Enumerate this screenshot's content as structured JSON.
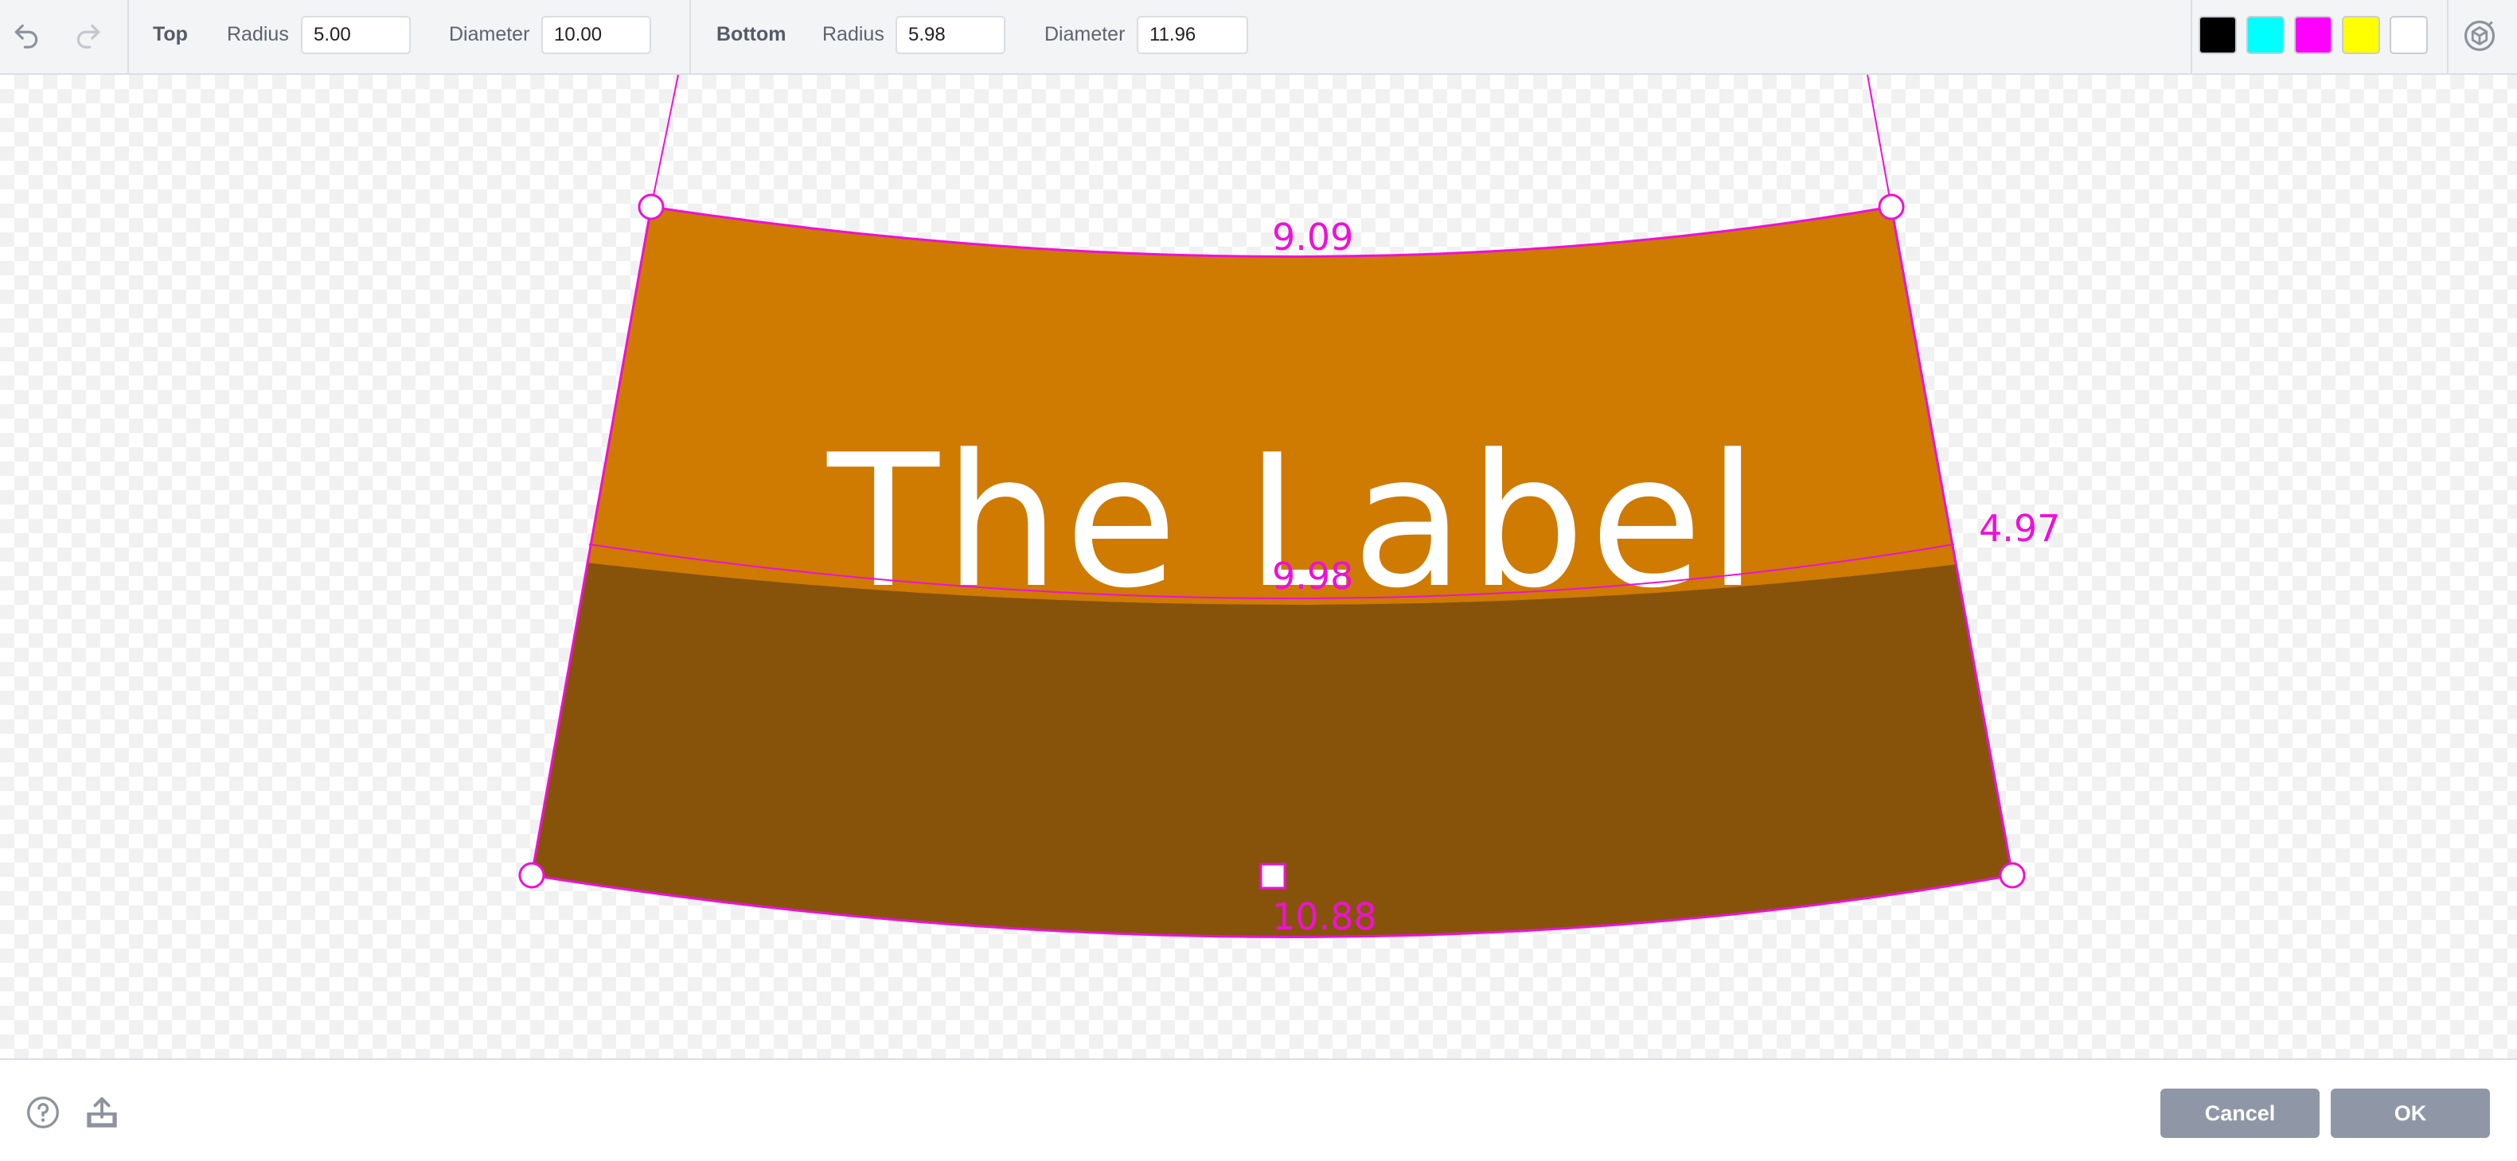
{
  "toolbar": {
    "top": {
      "section_label": "Top",
      "radius_label": "Radius",
      "radius_value": "5.00",
      "diameter_label": "Diameter",
      "diameter_value": "10.00"
    },
    "bottom": {
      "section_label": "Bottom",
      "radius_label": "Radius",
      "radius_value": "5.98",
      "diameter_label": "Diameter",
      "diameter_value": "11.96"
    },
    "icons": {
      "undo": "undo-icon",
      "redo": "redo-icon",
      "view_3d": "3d-view-icon"
    },
    "swatches": [
      {
        "name": "black",
        "color": "#000000"
      },
      {
        "name": "cyan",
        "color": "#00ffff"
      },
      {
        "name": "magenta",
        "color": "#ff00ff"
      },
      {
        "name": "yellow",
        "color": "#ffff00"
      },
      {
        "name": "white",
        "color": "#ffffff"
      }
    ]
  },
  "canvas": {
    "label_text": "The Label",
    "dimensions": {
      "top_width": "9.09",
      "middle_width": "9.98",
      "bottom_width": "10.88",
      "side_height": "4.97"
    },
    "colors": {
      "label_upper": "#cf7a00",
      "label_lower": "#87530b",
      "guide": "#ee10d8"
    }
  },
  "footer": {
    "icons": {
      "help": "help-icon",
      "export": "export-icon"
    },
    "cancel_label": "Cancel",
    "ok_label": "OK"
  }
}
